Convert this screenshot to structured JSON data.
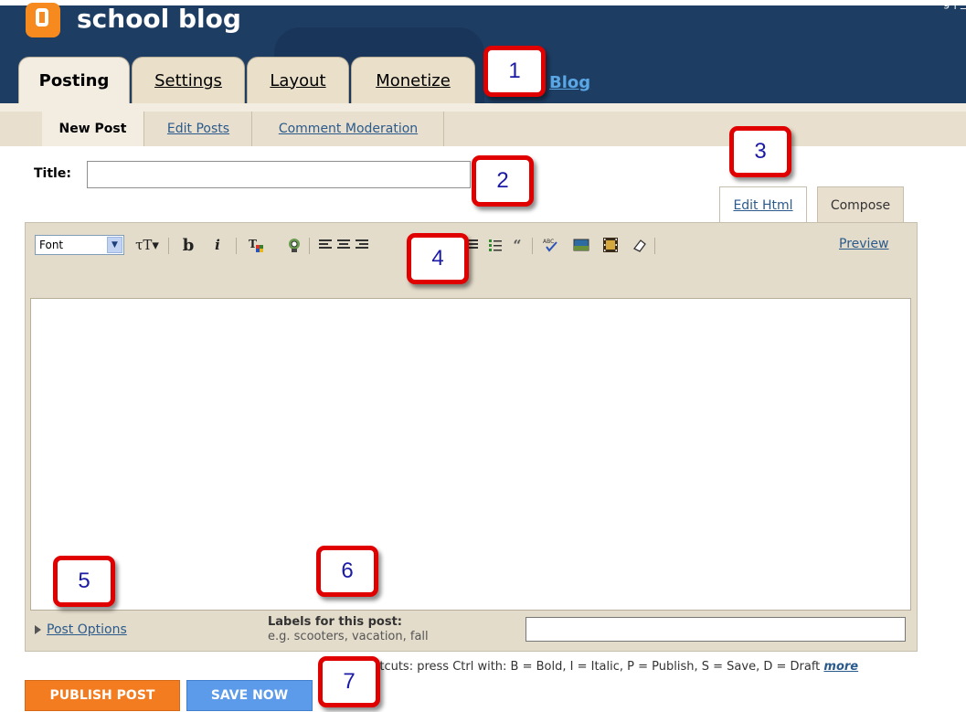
{
  "header": {
    "blog_title": "school blog",
    "corner_text": "g | _",
    "tabs": [
      {
        "label": "Posting"
      },
      {
        "label": "Settings"
      },
      {
        "label": "Layout"
      },
      {
        "label": "Monetize"
      }
    ],
    "blog_link": "Blog"
  },
  "subnav": {
    "items": [
      {
        "label": "New Post"
      },
      {
        "label": "Edit Posts"
      },
      {
        "label": "Comment Moderation"
      }
    ]
  },
  "post": {
    "title_label": "Title:",
    "title_value": ""
  },
  "editor": {
    "edit_html_label": "Edit Html",
    "compose_label": "Compose",
    "font_select": "Font",
    "preview_label": "Preview",
    "toolbar_icons": [
      "font-size-icon",
      "bold-icon",
      "italic-icon",
      "text-color-icon",
      "link-icon",
      "align-left-icon",
      "align-center-icon",
      "align-right-icon",
      "align-justify-icon",
      "numbered-list-icon",
      "bullet-list-icon",
      "blockquote-icon",
      "spellcheck-icon",
      "image-icon",
      "video-icon",
      "eraser-icon"
    ]
  },
  "post_options": {
    "label": "Post Options",
    "labels_title": "Labels for this post:",
    "labels_hint": "e.g. scooters, vacation, fall",
    "labels_value": ""
  },
  "shortcuts": {
    "text": "rtcuts: press Ctrl with: B = Bold, I = Italic, P = Publish, S = Save, D = Draft",
    "more_label": "more"
  },
  "buttons": {
    "publish": "PUBLISH POST",
    "save": "SAVE NOW"
  },
  "callouts": [
    "1",
    "2",
    "3",
    "4",
    "5",
    "6",
    "7"
  ],
  "colors": {
    "header_bg": "#1e3d63",
    "tab_bg": "#eadfc9",
    "publish": "#f47c20",
    "save": "#5b9bea",
    "callout_border": "#e00000"
  }
}
